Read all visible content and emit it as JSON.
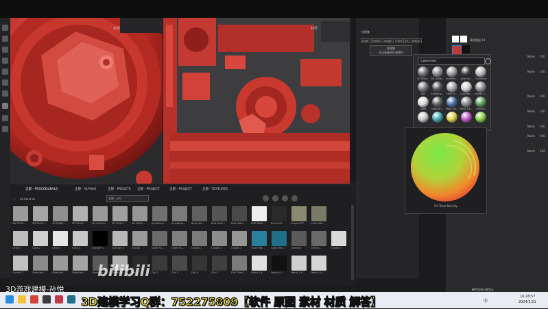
{
  "viewport3d": {
    "title": "材质"
  },
  "viewport2d": {
    "title": "材质"
  },
  "properties": {
    "title": "纹理集",
    "channels": [
      "color",
      "metal",
      "rough",
      "nrm",
      "h-t",
      "emiss"
    ],
    "note_line1": "纹理集",
    "note_line2": "无法直接进行该操作"
  },
  "layers": {
    "opacity_label": "填充图层 10",
    "rows": [
      {
        "blend": "Norm",
        "value": "100"
      },
      {
        "blend": "Norm",
        "value": "100"
      },
      {
        "blend": "Norm",
        "value": "100"
      },
      {
        "blend": "Norm",
        "value": "100"
      },
      {
        "blend": "Norm",
        "value": "100"
      },
      {
        "blend": "Norm",
        "value": "100"
      },
      {
        "blend": "Norm",
        "value": "100"
      }
    ]
  },
  "popup": {
    "search_value": "u.generator",
    "items": [
      {
        "label": "3D Dista...",
        "color": "#6f6f73"
      },
      {
        "label": "3D Linear...",
        "color": "#8a8a8e"
      },
      {
        "label": "Ambient...",
        "color": "#9a9a9d"
      },
      {
        "label": "Auto Sel...",
        "color": "#3a3a3d"
      },
      {
        "label": "Curvature",
        "color": "#b5b5b8"
      },
      {
        "label": "Dirt",
        "color": "#7a7a7e"
      },
      {
        "label": "Dripping...",
        "color": "#55555a"
      },
      {
        "label": "Fiber Gl...",
        "color": "#a4a4a8"
      },
      {
        "label": "Glaciate...",
        "color": "#cfcfd2"
      },
      {
        "label": "Inflate E...",
        "color": "#8e8e92"
      },
      {
        "label": "Light",
        "color": "#d8d8da"
      },
      {
        "label": "Mask Bu...",
        "color": "#606064"
      },
      {
        "label": "Mask Edi...",
        "color": "#4b6fa5"
      },
      {
        "label": "Mask Edi...",
        "color": "#8a8a8e"
      },
      {
        "label": "Position",
        "color": "#5a9a5e"
      },
      {
        "label": "",
        "color": "#c8c8cb"
      },
      {
        "label": "",
        "color": "#4aa7b0"
      },
      {
        "label": "",
        "color": "#e0d24a"
      },
      {
        "label": "",
        "color": "#c05ac8"
      },
      {
        "label": "",
        "color": "#8ad04a"
      }
    ]
  },
  "preview": {
    "label": "UV Texel Density"
  },
  "shelf": {
    "tabs": [
      "全部 - PROCEDURALS",
      "全部 - ALPHAS",
      "全部 - PRESETS",
      "全部 - PROJECT",
      "全部 - PROJECT",
      "全部 - TEXTURES"
    ],
    "all_libraries": "All libraries",
    "filter_value": "全部 - pro",
    "rows": [
      [
        {
          "label": "3D Perlin...",
          "color": "#9b9b9b"
        },
        {
          "label": "3D Perlin...",
          "color": "#a5a5a5"
        },
        {
          "label": "3D Ridge...",
          "color": "#8f8f8f"
        },
        {
          "label": "3D Simpl...",
          "color": "#b0b0b0"
        },
        {
          "label": "3D Voronoi",
          "color": "#9a9a9a"
        },
        {
          "label": "3D Voron...",
          "color": "#a0a0a0"
        },
        {
          "label": "3D Worle...",
          "color": "#969696"
        },
        {
          "label": "Anisotrop...",
          "color": "#707070"
        },
        {
          "label": "Anisotrop...",
          "color": "#7a7a7a"
        },
        {
          "label": "Blue Noi...",
          "color": "#606060"
        },
        {
          "label": "Brdf Spat...",
          "color": "#555555"
        },
        {
          "label": "Brdf Spat...",
          "color": "#4a4a4a"
        },
        {
          "label": "Brdf Spat...",
          "color": "#eeeeee"
        },
        {
          "label": "Bricks 01",
          "color": "#2a2a2a"
        },
        {
          "label": "Camo UCP",
          "color": "#8a8a70"
        },
        {
          "label": "Camo Wo...",
          "color": "#7a7a66"
        }
      ],
      [
        {
          "label": "Cells 1",
          "color": "#bdbdbd"
        },
        {
          "label": "Cells 2",
          "color": "#d0d0d0"
        },
        {
          "label": "Cells 3",
          "color": "#e5e5e5"
        },
        {
          "label": "Cells 4",
          "color": "#c8c8c8"
        },
        {
          "label": "Checker 1",
          "color": "#000000"
        },
        {
          "label": "Checker 2",
          "color": "#b8b8b8"
        },
        {
          "label": "Circles",
          "color": "#9a9a9a"
        },
        {
          "label": "Cloth Fo...",
          "color": "#6a6a6a"
        },
        {
          "label": "Cloth Fo...",
          "color": "#808080"
        },
        {
          "label": "Clouds 1",
          "color": "#7a7a7a"
        },
        {
          "label": "Clouds 2",
          "color": "#8c8c8c"
        },
        {
          "label": "Clouds 3",
          "color": "#969696"
        },
        {
          "label": "Color Wit...",
          "color": "#2a7f9a"
        },
        {
          "label": "Color Wit...",
          "color": "#1f6f88"
        },
        {
          "label": "Creased",
          "color": "#5a5a5a"
        },
        {
          "label": "Crease...",
          "color": "#6a6a6a"
        },
        {
          "label": "Crystal 1",
          "color": "#d8d8d8"
        }
      ],
      [
        {
          "label": "Crystal 2",
          "color": "#c0c0c0"
        },
        {
          "label": "Direction...",
          "color": "#8a8a8a"
        },
        {
          "label": "Direction...",
          "color": "#9a9a9a"
        },
        {
          "label": "Direction...",
          "color": "#a5a5a5"
        },
        {
          "label": "Direction...",
          "color": "#5a5a5a"
        },
        {
          "label": "Direction...",
          "color": "#b0b0b0"
        },
        {
          "label": "Dirt 1",
          "color": "#2a2a2a"
        },
        {
          "label": "Dirt 2",
          "color": "#3a3a3a"
        },
        {
          "label": "Dirt 3",
          "color": "#4a4a4a"
        },
        {
          "label": "Dirt 4",
          "color": "#353535"
        },
        {
          "label": "Dirt 5",
          "color": "#3f3f3f"
        },
        {
          "label": "Dirt Grad...",
          "color": "#7a7a7a"
        },
        {
          "label": "Fabric Ca...",
          "color": "#e0e0e0"
        },
        {
          "label": "Fabric Cr...",
          "color": "#111111"
        },
        {
          "label": "Fabric Ca...",
          "color": "#cfcfcf"
        },
        {
          "label": "Fabric Ca...",
          "color": "#d5d5d5"
        }
      ]
    ]
  },
  "banner": "3D建模学习Q群：752275809【软件 原图 素材 材质 解答】",
  "watermark_user": "3D游戏建模-孙悦",
  "watermark_site": "bilibili",
  "taskbar": {
    "time": "16:28:57",
    "date": "2024/2/21",
    "lang": "中",
    "status_text": "硬件加速已被禁止"
  },
  "colors": {
    "red_material": "#c7342c",
    "accent": "#2c8ce0"
  }
}
